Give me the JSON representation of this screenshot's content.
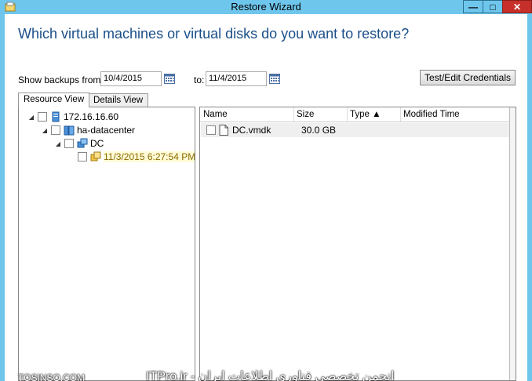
{
  "window": {
    "title": "Restore Wizard",
    "controls": {
      "minimize": "—",
      "maximize": "□",
      "close": "✕"
    }
  },
  "heading": "Which virtual machines or virtual disks do you want to restore?",
  "filters": {
    "from_label": "Show backups from:",
    "from_value": "10/4/2015",
    "to_label": "to:",
    "to_value": "11/4/2015",
    "calendar_icon": "calendar-icon"
  },
  "credentials_button": "Test/Edit Credentials",
  "tabs": [
    {
      "label": "Resource View",
      "active": true
    },
    {
      "label": "Details View",
      "active": false
    }
  ],
  "tree": [
    {
      "label": "172.16.16.60",
      "icon": "server-icon",
      "expander": "◢"
    },
    {
      "label": "ha-datacenter",
      "icon": "datacenter-icon",
      "expander": "◢"
    },
    {
      "label": "DC",
      "icon": "vm-icon",
      "expander": "◢"
    },
    {
      "label": "11/3/2015 6:27:54 PM",
      "icon": "snapshot-icon"
    }
  ],
  "list": {
    "columns": [
      "Name",
      "Size",
      "Type ▲",
      "Modified Time"
    ],
    "rows": [
      {
        "name": "DC.vmdk",
        "size": "30.0 GB",
        "type": "",
        "modified": ""
      }
    ]
  },
  "watermark": {
    "left": "TOSINSO.COM",
    "right": "ITPro.ir - انجمن تخصصی فناوری اطلاعات ایران"
  },
  "colors": {
    "titlebar": "#6fc6ec",
    "heading": "#1b4f8a",
    "close_button": "#c7302a"
  }
}
